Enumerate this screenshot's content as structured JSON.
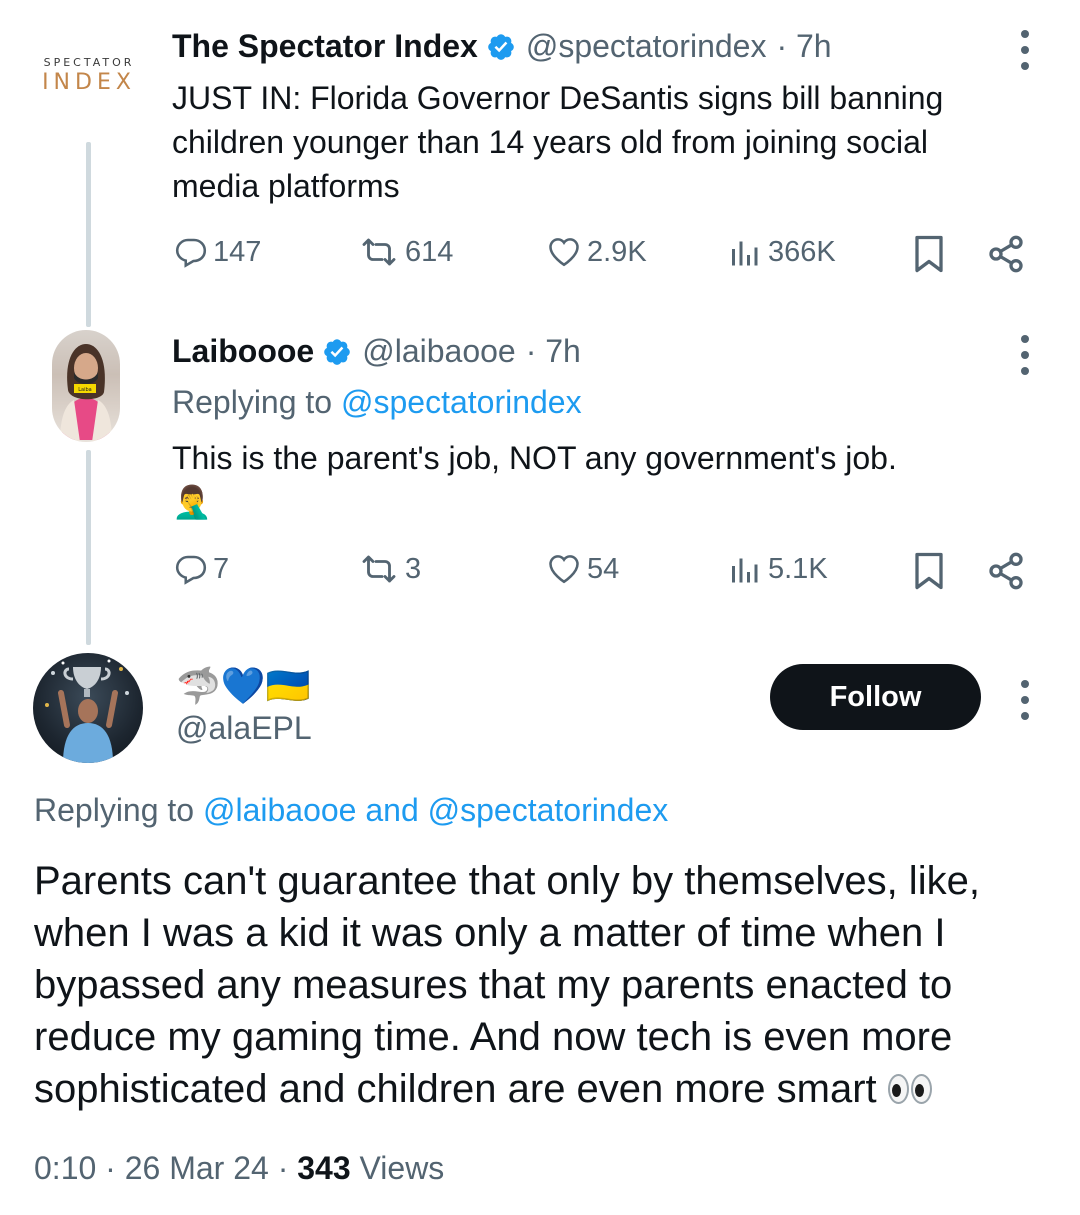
{
  "colors": {
    "link": "#1d9bf0",
    "verified": "#1d9bf0",
    "muted": "#536471",
    "text": "#0f1419",
    "thread_line": "#cfd9de",
    "follow_bg": "#0f1419"
  },
  "tweet1": {
    "avatar_top": "SPECTATOR",
    "avatar_bottom": "INDEX",
    "display_name": "The Spectator Index",
    "handle": "@spectatorindex",
    "time": "· 7h",
    "text": "JUST IN: Florida Governor DeSantis signs bill banning children younger than 14 years old from joining social media platforms",
    "replies": "147",
    "retweets": "614",
    "likes": "2.9K",
    "views": "366K"
  },
  "tweet2": {
    "display_name": "Laiboooe",
    "handle": "@laibaooe",
    "time": "· 7h",
    "replying_prefix": "Replying to",
    "replying_to": "@spectatorindex",
    "text": "This is the parent's job, NOT any government's job.",
    "emoji": "🤦‍♂️",
    "replies": "7",
    "retweets": "3",
    "likes": "54",
    "views": "5.1K"
  },
  "tweet3": {
    "display_name_emojis": "🦈💙🇺🇦",
    "handle": "@alaEPL",
    "follow_label": "Follow",
    "replying_prefix": "Replying to",
    "replying_to": "@laibaooe and @spectatorindex",
    "text": "Parents can't guarantee that only by themselves, like, when I was a kid it was only a matter of time when I bypassed any measures that my parents enacted to reduce my gaming time. And now tech is even more sophisticated and children are even more smart",
    "timestamp": "0:10 · 26 Mar 24 · ",
    "views_count": "343",
    "views_label": " Views"
  }
}
